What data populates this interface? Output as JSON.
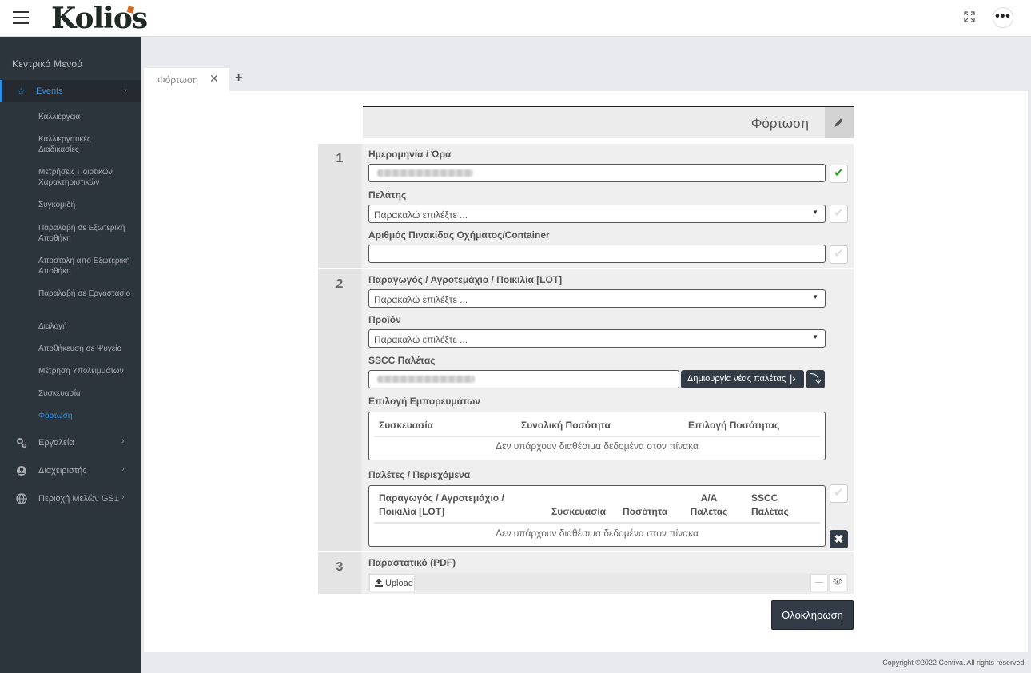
{
  "header": {
    "logo_text": "Kolios",
    "more_label": "•••"
  },
  "sidebar": {
    "title": "Κεντρικό Μενού",
    "events_label": "Events",
    "events_items": [
      {
        "label": "Καλλιέργεια"
      },
      {
        "label": "Καλλιεργητικές Διαδικασίες"
      },
      {
        "label": "Μετρήσεις Ποιοτικών Χαρακτηριστικών"
      },
      {
        "label": "Συγκομιδή"
      },
      {
        "label": "Παραλαβή σε Εξωτερική Αποθήκη"
      },
      {
        "label": "Αποστολή από Εξωτερική Αποθήκη"
      },
      {
        "label": "Παραλαβή σε Εργοστάσιο"
      },
      {
        "label": "Διαλογή"
      },
      {
        "label": "Αποθήκευση σε Ψυγείο"
      },
      {
        "label": "Μέτρηση Υπολειμμάτων"
      },
      {
        "label": "Συσκευασία"
      },
      {
        "label": "Φόρτωση",
        "active": true
      }
    ],
    "main_items": [
      {
        "label": "Εργαλεία",
        "icon": "cogs-icon"
      },
      {
        "label": "Διαχειριστής",
        "icon": "user-circle-icon"
      },
      {
        "label": "Περιοχή Μελών GS1",
        "icon": "globe-icon"
      }
    ]
  },
  "tabs": {
    "active_label": "Φόρτωση",
    "close_glyph": "✕",
    "add_glyph": "+"
  },
  "form": {
    "title": "Φόρτωση",
    "section1": {
      "number": "1",
      "datetime_label": "Ημερομηνία / Ώρα",
      "customer_label": "Πελάτης",
      "customer_placeholder": "Παρακαλώ επιλέξτε ...",
      "plate_label": "Αριθμός Πινακίδας Οχήματος/Container"
    },
    "section2": {
      "number": "2",
      "lot_label": "Παραγωγός / Αγροτεμάχιο / Ποικιλία [LOT]",
      "lot_placeholder": "Παρακαλώ επιλέξτε ...",
      "product_label": "Προϊόν",
      "product_placeholder": "Παρακαλώ επιλέξτε ...",
      "sscc_label": "SSCC Παλέτας",
      "new_pallet_button": "Δημιουργία νέας παλέτας",
      "goods_label": "Επιλογή Εμπορευμάτων",
      "goods_table": {
        "headers": [
          "Συσκευασία",
          "Συνολική Ποσότητα",
          "Επιλογή Ποσότητας"
        ],
        "empty": "Δεν υπάρχουν διαθέσιμα δεδομένα στον πίνακα"
      },
      "pallets_label": "Παλέτες / Περιεχόμενα",
      "pallets_table": {
        "headers": [
          "Παραγωγός / Αγροτεμάχιο / Ποικιλία [LOT]",
          "Συσκευασία",
          "Ποσότητα",
          "Α/Α Παλέτας",
          "SSCC Παλέτας"
        ],
        "empty": "Δεν υπάρχουν διαθέσιμα δεδομένα στον πίνακα"
      }
    },
    "section3": {
      "number": "3",
      "doc_label": "Παραστατικό (PDF)",
      "upload_label": "Upload"
    },
    "finish_button": "Ολοκλήρωση"
  },
  "footer": {
    "copyright": "Copyright ©2022 Centiva. All rights reserved."
  },
  "colors": {
    "sidebar_bg": "#2d353c",
    "accent": "#348fe2",
    "button_dark": "#333c46",
    "check_ok": "#22aa22"
  }
}
